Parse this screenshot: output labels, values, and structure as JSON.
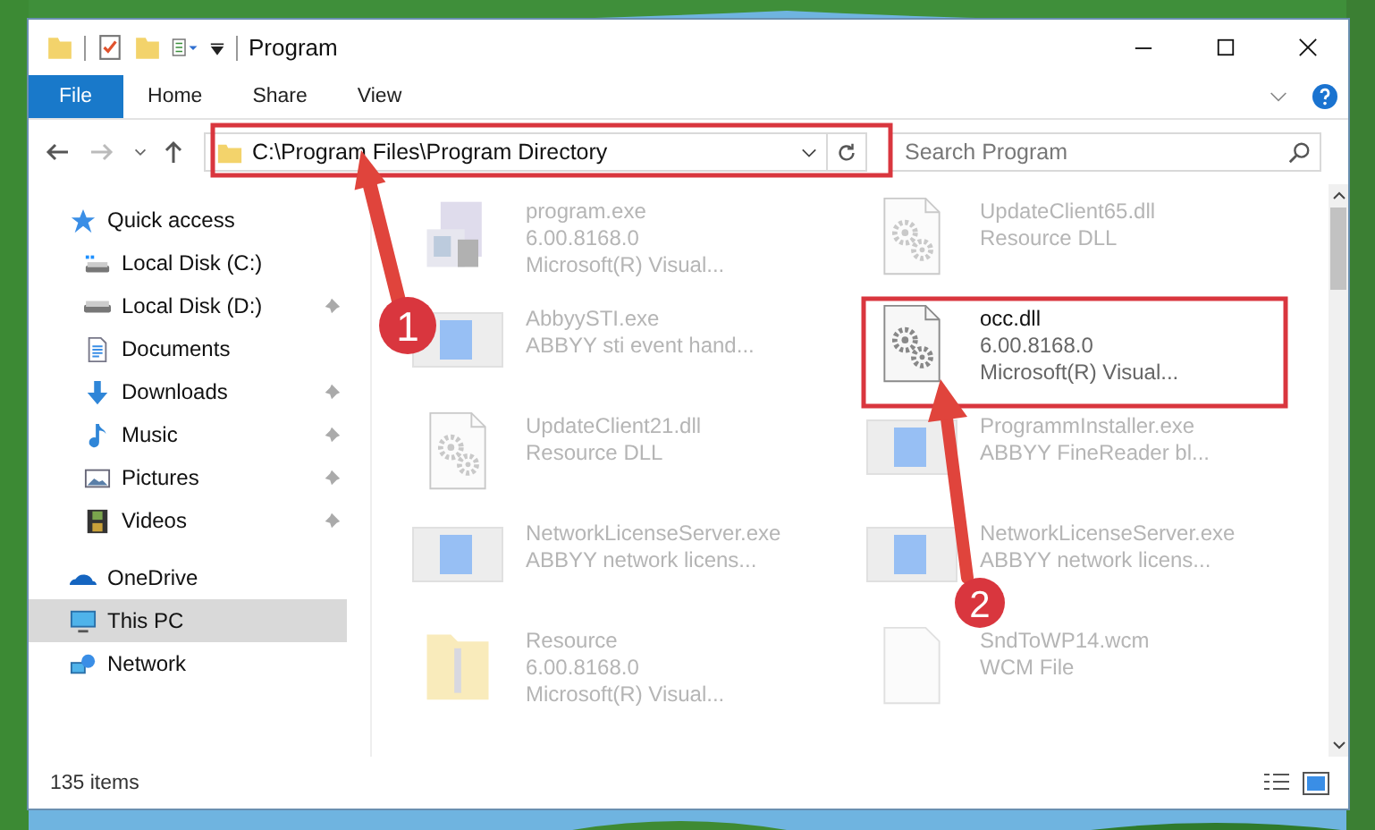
{
  "window": {
    "title": "Program"
  },
  "ribbon_tabs": [
    {
      "label": "File",
      "selected": true
    },
    {
      "label": "Home",
      "selected": false
    },
    {
      "label": "Share",
      "selected": false
    },
    {
      "label": "View",
      "selected": false
    }
  ],
  "address": {
    "path": "C:\\Program Files\\Program Directory"
  },
  "search": {
    "placeholder": "Search Program"
  },
  "sidebar": {
    "items": [
      {
        "label": "Quick access",
        "kind": "star",
        "selected": false,
        "children": [
          {
            "label": "Local Disk (C:)",
            "kind": "disk-c",
            "pinned": false,
            "selected": false
          },
          {
            "label": "Local Disk (D:)",
            "kind": "disk",
            "pinned": true,
            "selected": false
          },
          {
            "label": "Documents",
            "kind": "document",
            "pinned": false,
            "selected": false
          },
          {
            "label": "Downloads",
            "kind": "download",
            "pinned": true,
            "selected": false
          },
          {
            "label": "Music",
            "kind": "music",
            "pinned": true,
            "selected": false
          },
          {
            "label": "Pictures",
            "kind": "pictures",
            "pinned": true,
            "selected": false
          },
          {
            "label": "Videos",
            "kind": "videos",
            "pinned": true,
            "selected": false
          }
        ]
      },
      {
        "label": "OneDrive",
        "kind": "cloud",
        "selected": false
      },
      {
        "label": "This PC",
        "kind": "pc",
        "selected": true
      },
      {
        "label": "Network",
        "kind": "network",
        "selected": false
      }
    ]
  },
  "files": [
    {
      "name": "program.exe",
      "details": [
        "6.00.8168.0",
        "Microsoft(R) Visual..."
      ],
      "kind": "exe",
      "faded": true
    },
    {
      "name": "UpdateClient65.dll",
      "details": [
        "Resource DLL"
      ],
      "kind": "dll",
      "faded": true
    },
    {
      "name": "AbbyySTI.exe",
      "details": [
        "ABBYY sti event hand..."
      ],
      "kind": "app",
      "faded": true
    },
    {
      "name": "occ.dll",
      "details": [
        "6.00.8168.0",
        "Microsoft(R) Visual..."
      ],
      "kind": "dll",
      "faded": false
    },
    {
      "name": "UpdateClient21.dll",
      "details": [
        "Resource DLL"
      ],
      "kind": "dll",
      "faded": true
    },
    {
      "name": "ProgrammInstaller.exe",
      "details": [
        "ABBYY FineReader bl..."
      ],
      "kind": "app",
      "faded": true
    },
    {
      "name": "NetworkLicenseServer.exe",
      "details": [
        "ABBYY network licens..."
      ],
      "kind": "app",
      "faded": true
    },
    {
      "name": "NetworkLicenseServer.exe",
      "details": [
        "ABBYY network licens..."
      ],
      "kind": "app",
      "faded": true
    },
    {
      "name": "Resource",
      "details": [
        "6.00.8168.0",
        "Microsoft(R) Visual..."
      ],
      "kind": "folder",
      "faded": true
    },
    {
      "name": "SndToWP14.wcm",
      "details": [
        "WCM File"
      ],
      "kind": "blank",
      "faded": true
    }
  ],
  "status_bar": {
    "count": "135 items"
  },
  "annotations": [
    {
      "number": "1"
    },
    {
      "number": "2"
    }
  ]
}
